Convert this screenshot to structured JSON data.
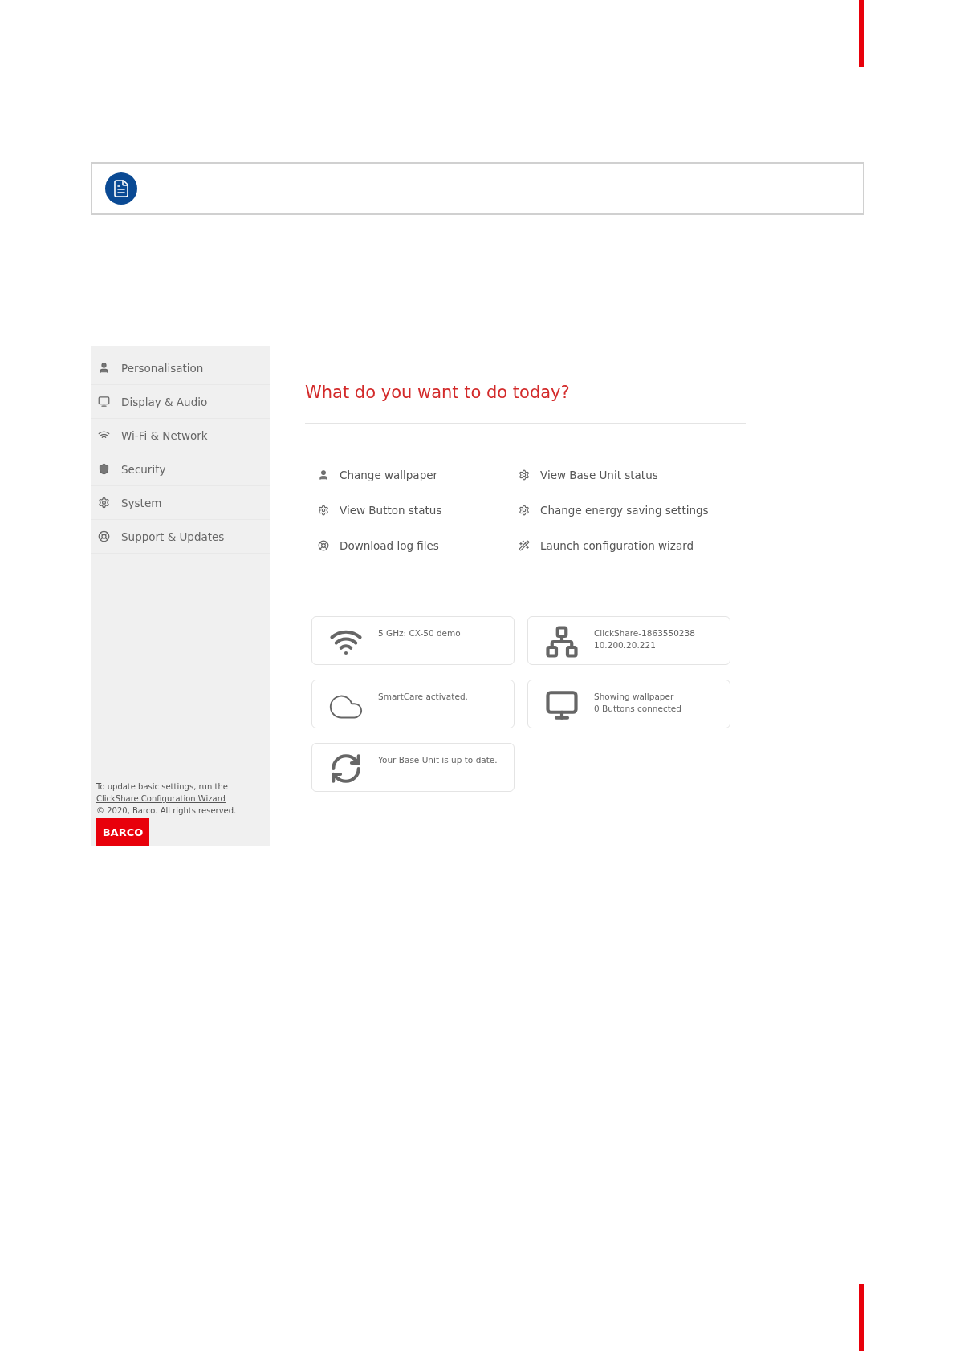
{
  "sidebar": {
    "items": [
      {
        "label": "Personalisation",
        "kind": "person"
      },
      {
        "label": "Display & Audio",
        "kind": "monitor"
      },
      {
        "label": "Wi-Fi & Network",
        "kind": "wifi"
      },
      {
        "label": "Security",
        "kind": "shield"
      },
      {
        "label": "System",
        "kind": "gear"
      },
      {
        "label": "Support & Updates",
        "kind": "lifebuoy"
      }
    ],
    "footer": {
      "text": "To update basic settings, run the",
      "link": "ClickShare Configuration Wizard",
      "copyright": "© 2020, Barco. All rights reserved.",
      "logo": "BARCO"
    }
  },
  "main": {
    "heading": "What do you want to do today?",
    "actions": [
      {
        "label": "Change wallpaper",
        "kind": "person"
      },
      {
        "label": "View Base Unit status",
        "kind": "gear"
      },
      {
        "label": "View Button status",
        "kind": "gear"
      },
      {
        "label": "Change energy saving settings",
        "kind": "gear"
      },
      {
        "label": "Download log files",
        "kind": "lifebuoy"
      },
      {
        "label": "Launch configuration wizard",
        "kind": "wand"
      }
    ],
    "cards": [
      {
        "kind": "wifi",
        "lines": [
          "5 GHz: CX-50 demo"
        ]
      },
      {
        "kind": "network",
        "lines": [
          "ClickShare-1863550238",
          "10.200.20.221"
        ]
      },
      {
        "kind": "cloud",
        "lines": [
          "SmartCare activated."
        ]
      },
      {
        "kind": "monitor",
        "lines": [
          "Showing wallpaper",
          "0 Buttons connected"
        ]
      },
      {
        "kind": "sync",
        "lines": [
          "Your Base Unit is up to date."
        ]
      }
    ]
  }
}
